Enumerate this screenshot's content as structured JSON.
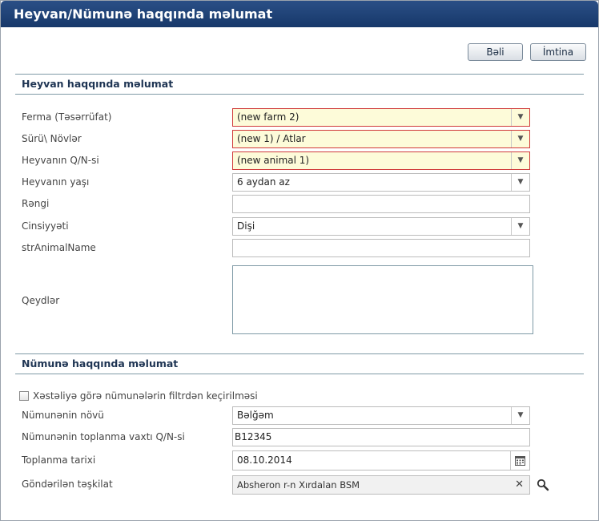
{
  "title": "Heyvan/Nümunə haqqında məlumat",
  "buttons": {
    "yes": "Bəli",
    "cancel": "İmtina"
  },
  "animal_section": {
    "heading": "Heyvan haqqında məlumat",
    "fields": {
      "farm": {
        "label": "Ferma (Təsərrüfat)",
        "value": "(new farm 2)"
      },
      "herd": {
        "label": "Sürü\\ Növlər",
        "value": "(new 1) / Atlar"
      },
      "animal_id": {
        "label": "Heyvanın Q/N-si",
        "value": "(new animal 1)"
      },
      "age": {
        "label": "Heyvanın yaşı",
        "value": "6 aydan az"
      },
      "color": {
        "label": "Rəngi",
        "value": ""
      },
      "sex": {
        "label": "Cinsiyyəti",
        "value": "Dişi"
      },
      "name": {
        "label": "strAnimalName",
        "value": ""
      },
      "notes": {
        "label": "Qeydlər",
        "value": ""
      }
    }
  },
  "sample_section": {
    "heading": "Nümunə haqqında məlumat",
    "filter_checkbox": {
      "label": "Xəstəliyə görə nümunələrin filtrdən keçirilməsi",
      "checked": false
    },
    "fields": {
      "sample_type": {
        "label": "Nümunənin növü",
        "value": "Bəlğəm"
      },
      "collection_id": {
        "label": "Nümunənin toplanma vaxtı Q/N-si",
        "value": "B12345"
      },
      "collection_date": {
        "label": "Toplanma tarixi",
        "value": "08.10.2014"
      },
      "sent_to": {
        "label": "Göndərilən təşkilat",
        "value": "Absheron r-n Xırdalan BSM"
      }
    }
  },
  "icons": [
    "chevron-down-icon",
    "calendar-icon",
    "clear-icon",
    "search-icon"
  ],
  "colors": {
    "title_bar": "#1b3d70",
    "required_border": "#d03a3a",
    "required_bg": "#fdfbd9"
  }
}
